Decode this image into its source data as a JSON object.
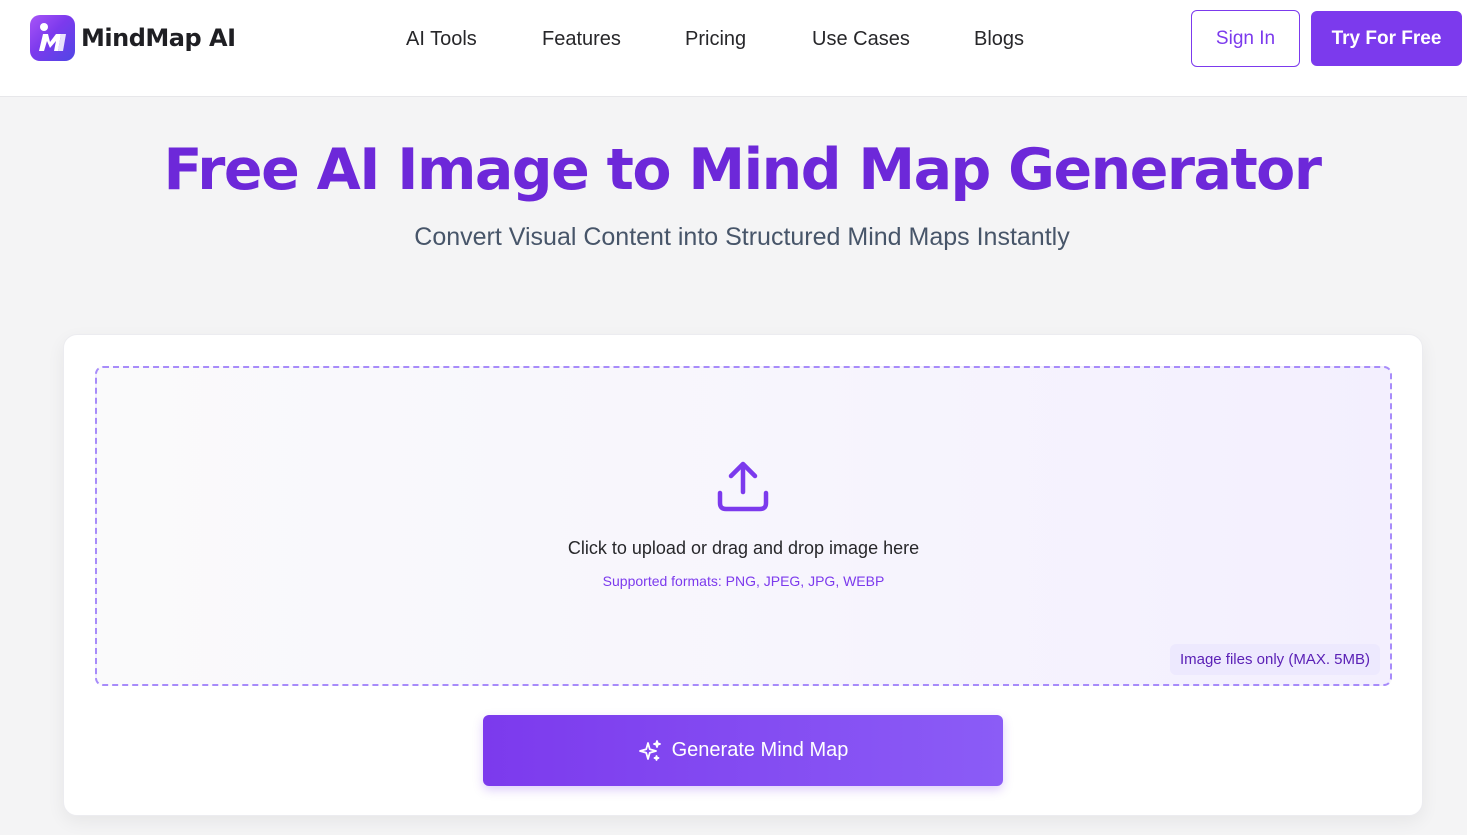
{
  "brand": {
    "name": "MindMap AI",
    "accent": "#7c3aed",
    "title_color": "#6d28d9"
  },
  "nav": {
    "items": [
      {
        "label": "AI Tools"
      },
      {
        "label": "Features"
      },
      {
        "label": "Pricing"
      },
      {
        "label": "Use Cases"
      },
      {
        "label": "Blogs"
      }
    ],
    "sign_in_label": "Sign In",
    "try_free_label": "Try For Free"
  },
  "hero": {
    "title": "Free AI Image to Mind Map Generator",
    "subtitle": "Convert Visual Content into Structured Mind Maps Instantly"
  },
  "upload": {
    "icon": "upload-icon",
    "prompt": "Click to upload or drag and drop image here",
    "formats": "Supported formats: PNG, JPEG, JPG, WEBP",
    "limit": "Image files only (MAX. 5MB)"
  },
  "generate": {
    "icon": "sparkles-icon",
    "label": "Generate Mind Map"
  }
}
